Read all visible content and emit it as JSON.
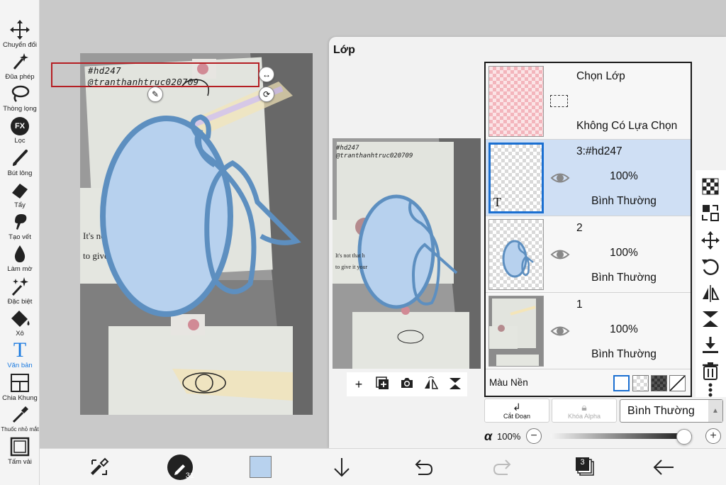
{
  "tools": [
    {
      "id": "transform",
      "label": "Chuyển đổi",
      "icon": "move-arrows-icon"
    },
    {
      "id": "magic-wand",
      "label": "Đũa phép",
      "icon": "magic-wand-icon"
    },
    {
      "id": "lasso",
      "label": "Thòng lọng",
      "icon": "lasso-icon"
    },
    {
      "id": "filter",
      "label": "Lọc",
      "icon": "fx-icon",
      "glyph": "FX"
    },
    {
      "id": "brush",
      "label": "Bút lông",
      "icon": "brush-icon"
    },
    {
      "id": "eraser",
      "label": "Tẩy",
      "icon": "eraser-icon"
    },
    {
      "id": "smudge",
      "label": "Tạo vết",
      "icon": "smudge-icon"
    },
    {
      "id": "blur",
      "label": "Làm mờ",
      "icon": "blur-drop-icon"
    },
    {
      "id": "special",
      "label": "Đặc biệt",
      "icon": "sparkle-icon"
    },
    {
      "id": "fill",
      "label": "Xô",
      "icon": "bucket-icon"
    },
    {
      "id": "text",
      "label": "Văn bản",
      "icon": "text-icon",
      "glyph": "T",
      "active": true
    },
    {
      "id": "frame",
      "label": "Chia Khung",
      "icon": "frame-divider-icon"
    },
    {
      "id": "eyedropper",
      "label": "Thuốc nhỏ mắt",
      "icon": "eyedropper-icon"
    },
    {
      "id": "canvas",
      "label": "Tấm vải",
      "icon": "canvas-icon"
    }
  ],
  "canvas": {
    "watermark_line1": "#hd247",
    "watermark_line2": "@tranthanhtruc020709",
    "note_text_1": "It's not that h",
    "note_text_2": "to give it your"
  },
  "panel": {
    "title": "Lớp",
    "preview_line1": "#hd247",
    "preview_line2": "@tranthanhtruc020709",
    "preview_note_1": "It's not that h",
    "preview_note_2": "to give it your",
    "preview_actions": [
      "add-layer-icon",
      "add-layer-copy-icon",
      "camera-icon",
      "flip-layer-icon",
      "merge-down-icon"
    ],
    "selection_row": {
      "title": "Chọn Lớp",
      "status": "Không Có Lựa Chọn"
    },
    "layers": [
      {
        "name": "3:#hd247",
        "opacity": "100%",
        "blend": "Bình Thường",
        "selected": true,
        "thumb_glyph": "T"
      },
      {
        "name": "2",
        "opacity": "100%",
        "blend": "Bình Thường",
        "selected": false
      },
      {
        "name": "1",
        "opacity": "100%",
        "blend": "Bình Thường",
        "selected": false
      }
    ],
    "bg_color_label": "Màu Nền",
    "clip_label": "Cắt Đoạn",
    "alpha_lock_label": "Khóa Alpha",
    "blend_mode": "Bình Thường",
    "alpha_symbol": "α",
    "alpha_value": "100%",
    "alpha_fraction": 1.0
  },
  "bottom_bar": {
    "brush_size": "31",
    "layer_count": "3",
    "color_swatch": "#b8d2ee"
  },
  "colors": {
    "accent": "#1a7ae0",
    "selected_layer": "#cfdff4",
    "selection_box": "#b51f24",
    "shape_fill": "#b7d1ee",
    "shape_stroke": "#5d8fc0"
  }
}
